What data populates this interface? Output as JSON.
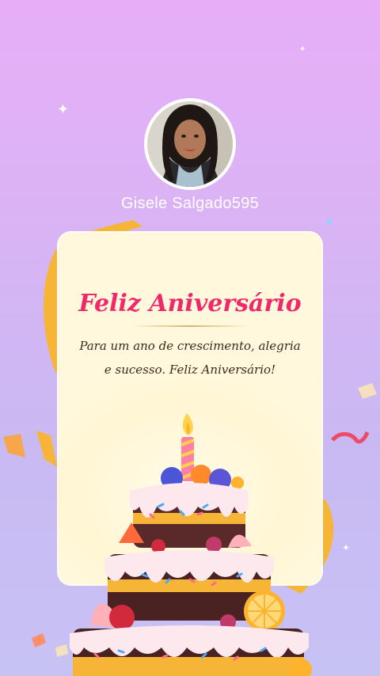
{
  "profile": {
    "username": "Gisele Salgado595"
  },
  "card": {
    "title": "Feliz Aniversário",
    "message": "Para um ano de crescimento, alegria e sucesso. Feliz Aniversário!"
  },
  "colors": {
    "background_top": "#e7aef7",
    "background_bottom": "#c7c2f4",
    "card_background": "#fff8dc",
    "title": "#f0296a",
    "ribbon": "#f6b536"
  },
  "icons": {
    "sparkle": "four-point-star",
    "cake": "birthday-cake"
  }
}
